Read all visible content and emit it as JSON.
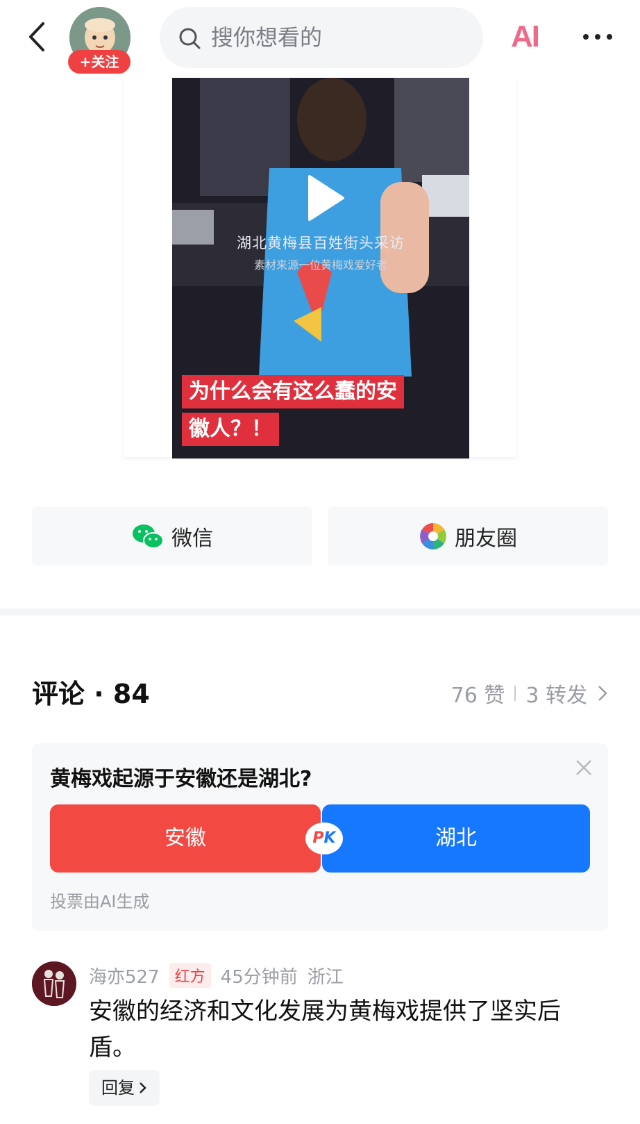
{
  "header": {
    "follow_label": "+关注",
    "search_placeholder": "搜你想看的",
    "ai_label": "AI"
  },
  "video": {
    "overlay_title": "湖北黄梅县百姓街头采访",
    "overlay_subtitle": "素材来源一位黄梅戏爱好者",
    "caption_line1": "为什么会有这么蠢的安",
    "caption_line2": "徽人？！"
  },
  "share": {
    "wechat_label": "微信",
    "moments_label": "朋友圈"
  },
  "comments": {
    "title": "评论 · 84",
    "likes": "76 赞",
    "reposts": "3 转发"
  },
  "poll": {
    "question": "黄梅戏起源于安徽还是湖北?",
    "option_a": "安徽",
    "option_b": "湖北",
    "pk_p": "P",
    "pk_k": "K",
    "note": "投票由AI生成"
  },
  "comment": {
    "username": "海亦527",
    "badge": "红方",
    "time": "45分钟前",
    "location": "浙江",
    "text": "安徽的经济和文化发展为黄梅戏提供了坚实后盾。",
    "reply_label": "回复"
  },
  "colors": {
    "accent_red": "#f04142",
    "poll_red": "#f24a42",
    "poll_blue": "#1677ff",
    "wechat_green": "#07c160"
  }
}
